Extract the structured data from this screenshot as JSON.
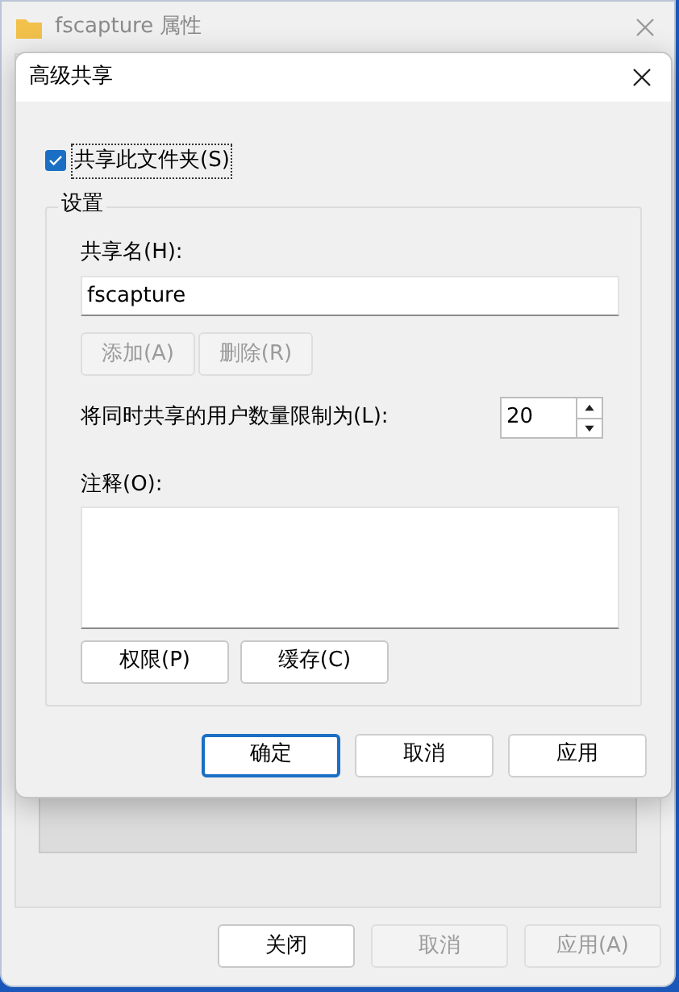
{
  "back_window": {
    "title": "fscapture 属性",
    "buttons": [
      {
        "label": "关闭",
        "disabled": false
      },
      {
        "label": "取消",
        "disabled": true
      },
      {
        "label": "应用(A)",
        "disabled": true
      }
    ]
  },
  "dialog": {
    "title": "高级共享",
    "share_checkbox": {
      "label": "共享此文件夹(S)",
      "checked": true
    },
    "settings": {
      "title": "设置",
      "share_name_label": "共享名(H):",
      "share_name_value": "fscapture",
      "name_buttons": [
        {
          "label": "添加(A)",
          "disabled": true
        },
        {
          "label": "删除(R)",
          "disabled": true
        }
      ],
      "limit_label": "将同时共享的用户数量限制为(L):",
      "limit_value": "20",
      "comment_label": "注释(O):",
      "buttons": [
        {
          "label": "权限(P)",
          "disabled": false
        },
        {
          "label": "缓存(C)",
          "disabled": false
        }
      ]
    },
    "buttons": [
      {
        "label": "确定",
        "default": true
      },
      {
        "label": "取消",
        "default": false
      },
      {
        "label": "应用",
        "default": false
      }
    ]
  }
}
